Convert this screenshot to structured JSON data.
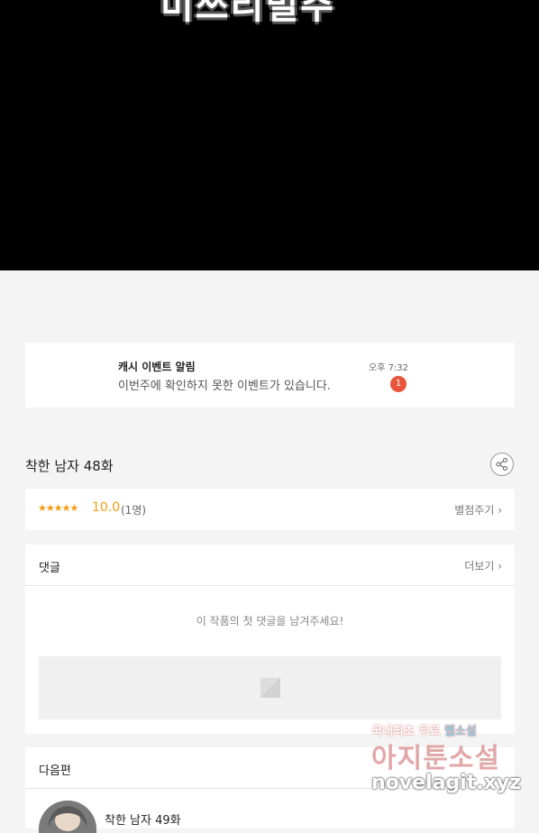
{
  "hero": {
    "text": "미쓰리빌주"
  },
  "notification": {
    "title": "캐시 이벤트 알림",
    "message": "이번주에 확인하지 못한 이벤트가 있습니다.",
    "time": "오후 7:32",
    "badge": "1"
  },
  "episode": {
    "title": "착한 남자 48화",
    "share_icon": "share-icon"
  },
  "rating": {
    "stars": "★★★★★",
    "score": "10.0",
    "count": "(1명)",
    "rate_label": "별점주기 ›"
  },
  "comments": {
    "title": "댓글",
    "more_label": "더보기 ›",
    "empty_text": "이 작품의 첫 댓글을 남겨주세요!"
  },
  "next": {
    "title": "다음편",
    "episode_title": "착한 남자 49화"
  },
  "watermark": {
    "line1_a": "국내최초 무료",
    "line1_b": "웹소설",
    "line2": "아지툰소설",
    "line3": "novelagit.xyz"
  },
  "colors": {
    "accent": "#f39c12",
    "badge": "#e8553b"
  }
}
